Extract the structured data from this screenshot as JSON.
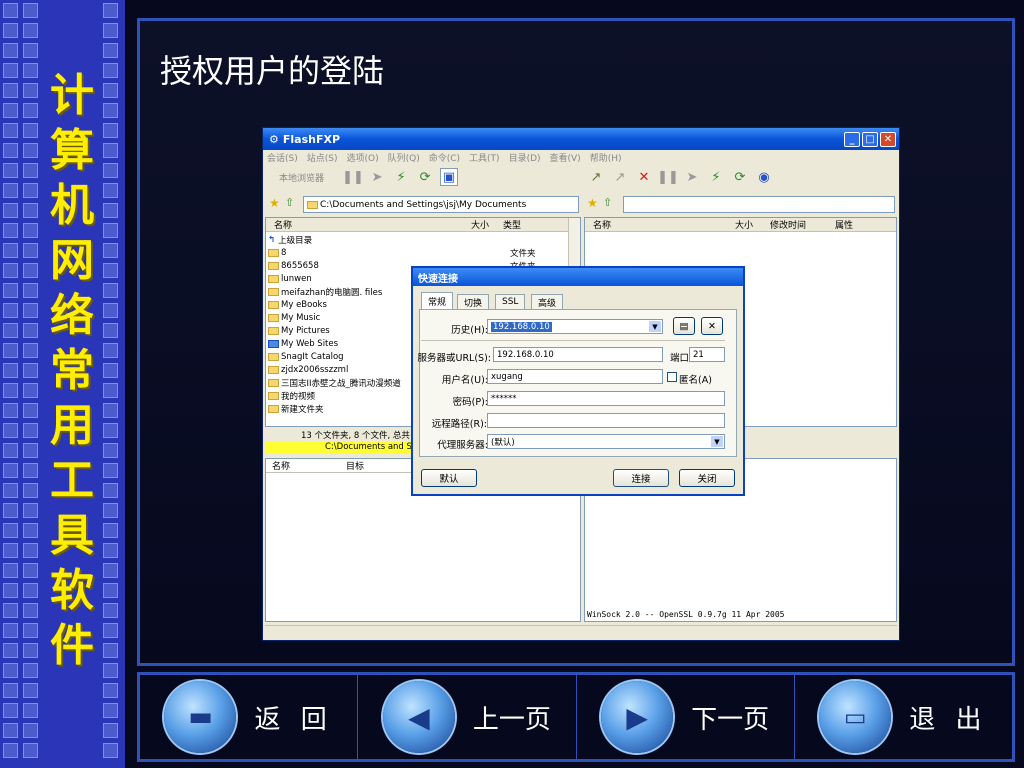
{
  "slide": {
    "side_title": [
      "计",
      "算",
      "机",
      "网",
      "络",
      "常",
      "用",
      "工",
      "具",
      "软",
      "件"
    ],
    "title": "授权用户的登陆"
  },
  "nav": [
    {
      "label": "返 回",
      "icon": "home-icon"
    },
    {
      "label": "上一页",
      "icon": "previous-page-icon"
    },
    {
      "label": "下一页",
      "icon": "next-page-icon"
    },
    {
      "label": "退 出",
      "icon": "exit-icon"
    }
  ],
  "app": {
    "title": "FlashFXP",
    "menu": [
      "会话(S)",
      "站点(S)",
      "选项(O)",
      "队列(Q)",
      "命令(C)",
      "工具(T)",
      "目录(D)",
      "查看(V)",
      "帮助(H)"
    ],
    "local_browser_label": "本地浏览器",
    "left_path": "C:\\Documents and Settings\\jsj\\My Documents",
    "left_columns": {
      "name": "名称",
      "size": "大小",
      "type": "类型"
    },
    "right_columns": {
      "name": "名称",
      "size": "大小",
      "modified": "修改时间",
      "attr": "属性"
    },
    "files": [
      {
        "name": "上级目录",
        "type": ""
      },
      {
        "name": "8",
        "type": "文件夹"
      },
      {
        "name": "8655658",
        "type": "文件夹"
      },
      {
        "name": "lunwen",
        "type": ""
      },
      {
        "name": "meifazhan的电脑圆. files",
        "type": ""
      },
      {
        "name": "My eBooks",
        "type": ""
      },
      {
        "name": "My Music",
        "type": ""
      },
      {
        "name": "My Pictures",
        "type": ""
      },
      {
        "name": "My Web Sites",
        "type": ""
      },
      {
        "name": "SnagIt Catalog",
        "type": ""
      },
      {
        "name": "zjdx2006sszzml",
        "type": ""
      },
      {
        "name": "三国志II赤壁之战_腾讯动漫频道",
        "type": ""
      },
      {
        "name": "我的视频",
        "type": ""
      },
      {
        "name": "新建文件夹",
        "type": ""
      }
    ],
    "status_line": "13 个文件夹, 8 个文件, 总共",
    "status_path": "C:\\Documents and Se",
    "queue_columns": {
      "name": "名称",
      "target": "目标"
    },
    "log_line": "WinSock 2.0 -- OpenSSL 0.9.7g 11 Apr 2005"
  },
  "dialog": {
    "title": "快速连接",
    "tabs": [
      "常规",
      "切换",
      "SSL",
      "高级"
    ],
    "history_label": "历史(H):",
    "history_value": "192.168.0.10",
    "server_label": "服务器或URL(S):",
    "server_value": "192.168.0.10",
    "port_label": "端口",
    "port_value": "21",
    "user_label": "用户名(U):",
    "user_value": "xugang",
    "anon_label": "匿名(A)",
    "password_label": "密码(P):",
    "password_value": "******",
    "remote_label": "远程路径(R):",
    "remote_value": "",
    "proxy_label": "代理服务器:",
    "proxy_value": "(默认)",
    "default_btn": "默认",
    "connect_btn": "连接",
    "close_btn": "关闭"
  },
  "colors": {
    "side_bg": "#2b35b8",
    "side_text": "#ffee00",
    "frame": "#2e52b8"
  }
}
